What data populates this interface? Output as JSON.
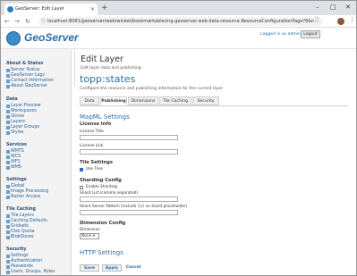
{
  "browser": {
    "tab_title": "GeoServer: Edit Layer",
    "tab_close": "×",
    "new_tab": "+",
    "url": "localhost:8081/geoserver/web/wicket/bookmarkable/org.geoserver.web.data.resource.ResourceConfigurationPage?6&n...",
    "window_controls": {
      "min": "–",
      "max": "□",
      "close": "✕"
    }
  },
  "header": {
    "brand": "GeoServer",
    "logged_in": "Logged in as admin.",
    "logout": "Logout"
  },
  "sidebar": {
    "sections": [
      {
        "title": "About & Status",
        "items": [
          "Server Status",
          "GeoServer Logs",
          "Contact Information",
          "About GeoServer"
        ]
      },
      {
        "title": "Data",
        "items": [
          "Layer Preview",
          "Workspaces",
          "Stores",
          "Layers",
          "Layer Groups",
          "Styles"
        ]
      },
      {
        "title": "Services",
        "items": [
          "WMTS",
          "WCS",
          "WFS",
          "WMS"
        ]
      },
      {
        "title": "Settings",
        "items": [
          "Global",
          "Image Processing",
          "Raster Access"
        ]
      },
      {
        "title": "Tile Caching",
        "items": [
          "Tile Layers",
          "Caching Defaults",
          "Gridsets",
          "Disk Quota",
          "BlobStores"
        ]
      },
      {
        "title": "Security",
        "items": [
          "Settings",
          "Authentication",
          "Passwords",
          "Users, Groups, Roles"
        ]
      }
    ]
  },
  "main": {
    "title": "Edit Layer",
    "subtitle": "Edit layer data and publishing",
    "layer_name": "topp:states",
    "layer_desc": "Configure the resource and publishing information for the current layer",
    "tabs": [
      "Data",
      "Publishing",
      "Dimensions",
      "Tile Caching",
      "Security"
    ],
    "active_tab": "Publishing",
    "mapml": {
      "heading": "MapML Settings",
      "license_info": "License Info",
      "license_title": "License Title",
      "license_link": "License Link",
      "tile_settings": "Tile Settings",
      "use_tiles": "Use Tiles",
      "use_tiles_checked": true,
      "sharding_config": "Sharding Config",
      "enable_sharding": "Enable Sharding",
      "enable_sharding_checked": false,
      "shard_list": "Shard List (comma separated)",
      "shard_server_pattern": "Shard Server Pattern (include {s} as shard placeholder)",
      "dimension_config": "Dimension Config",
      "dimension": "Dimension",
      "dimension_value": "None"
    },
    "http": {
      "heading": "HTTP Settings"
    },
    "actions": {
      "save": "Save",
      "apply": "Apply",
      "cancel": "Cancel"
    }
  }
}
